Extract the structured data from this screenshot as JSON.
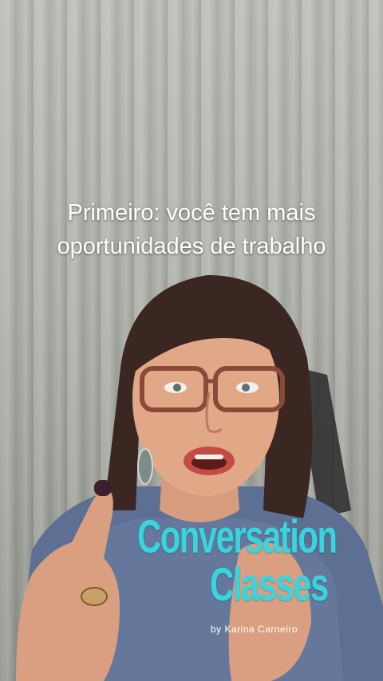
{
  "caption": {
    "line1": "Primeiro: você tem mais",
    "line2": "oportunidades de trabalho"
  },
  "logo": {
    "line1": "Conversation",
    "line2": "Classes",
    "byline": "by Karina Carneiro"
  },
  "colors": {
    "logo_accent": "#37d6de",
    "caption_text": "#ffffff"
  }
}
